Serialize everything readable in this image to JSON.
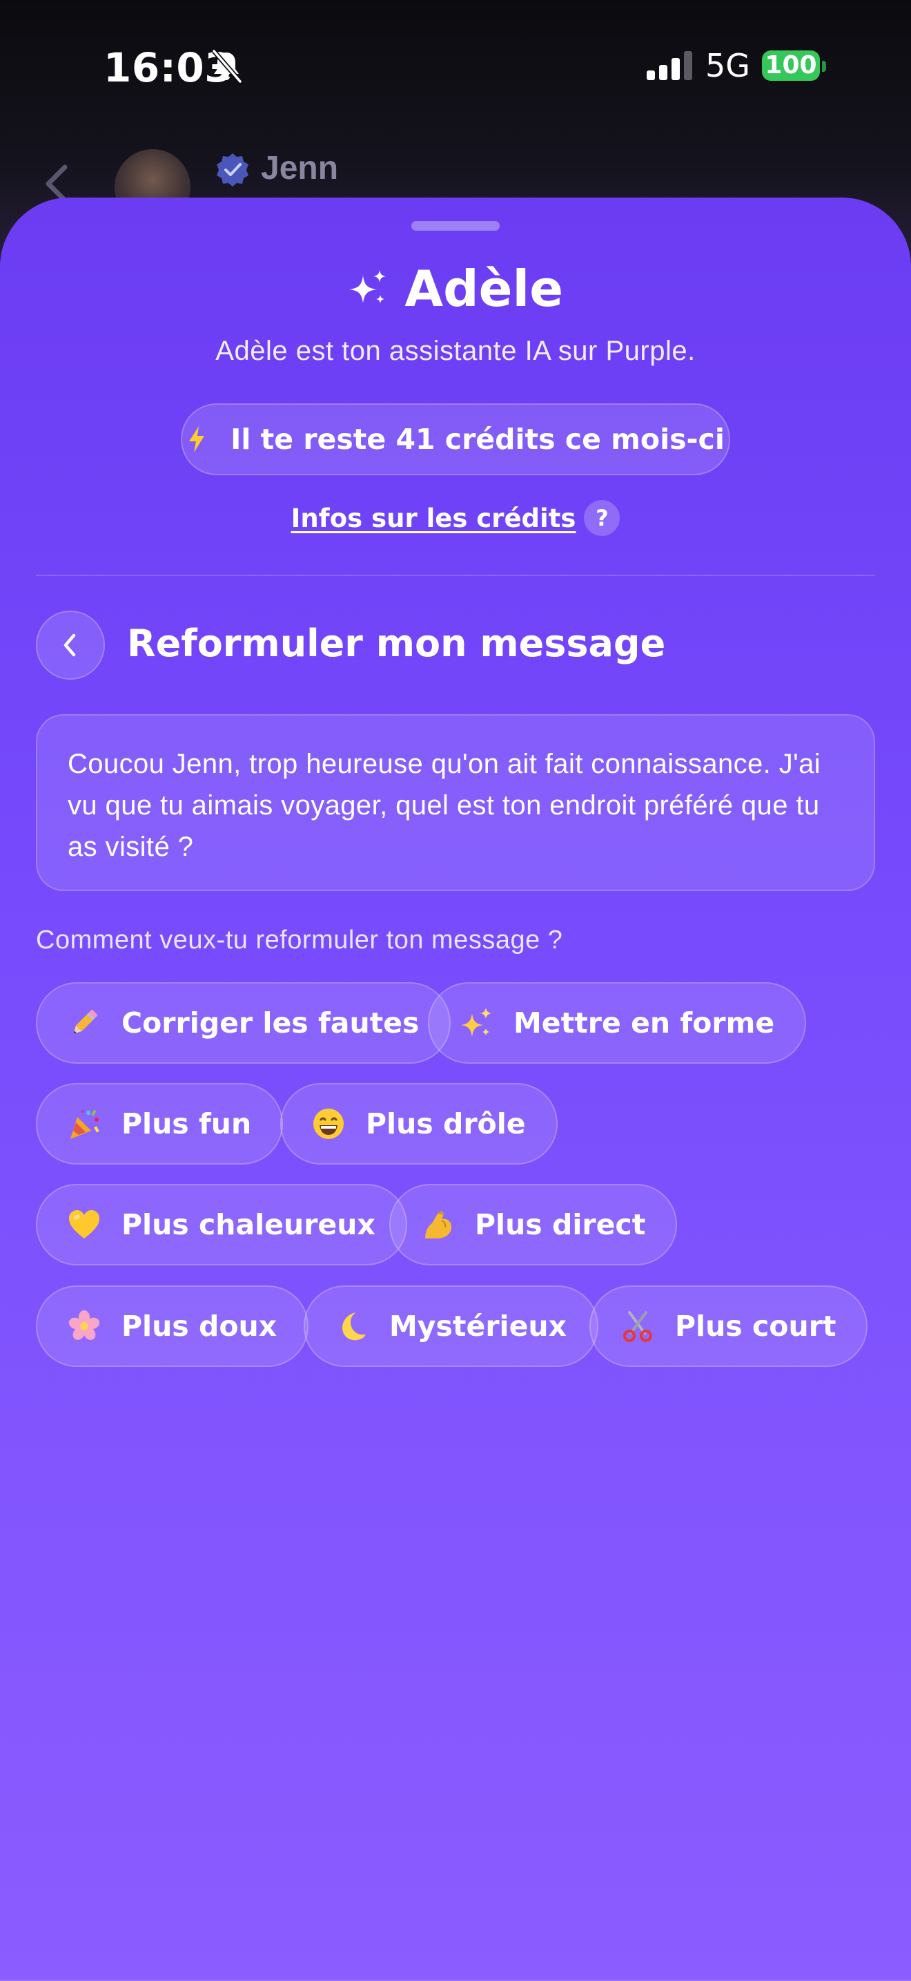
{
  "status_bar": {
    "time": "16:03",
    "network": "5G",
    "battery": "100"
  },
  "background_chat": {
    "contact_name": "Jenn"
  },
  "sheet": {
    "title": "Adèle",
    "subtitle": "Adèle est ton assistante IA sur Purple.",
    "credits_text": "Il te reste 41 crédits ce mois-ci",
    "credits_info_link": "Infos sur les crédits",
    "help_badge": "?",
    "section_title": "Reformuler mon message",
    "message": "Coucou Jenn, trop heureuse qu'on ait fait connaissance. J'ai vu que tu aimais voyager, quel est ton endroit préféré que tu as visité ?",
    "prompt": "Comment veux-tu reformuler ton message ?",
    "options": [
      {
        "label": "Corriger les fautes",
        "icon": "pencil-icon"
      },
      {
        "label": "Mettre en forme",
        "icon": "sparkles-icon"
      },
      {
        "label": "Plus fun",
        "icon": "party-popper-icon"
      },
      {
        "label": "Plus drôle",
        "icon": "grinning-face-icon"
      },
      {
        "label": "Plus chaleureux",
        "icon": "yellow-heart-icon"
      },
      {
        "label": "Plus direct",
        "icon": "flexed-biceps-icon"
      },
      {
        "label": "Plus doux",
        "icon": "cherry-blossom-icon"
      },
      {
        "label": "Mystérieux",
        "icon": "crescent-moon-icon"
      },
      {
        "label": "Plus court",
        "icon": "scissors-icon"
      }
    ]
  },
  "colors": {
    "sheet_top": "#6b3cf2",
    "sheet_bottom": "#8b5cff",
    "battery_green": "#34c759"
  }
}
